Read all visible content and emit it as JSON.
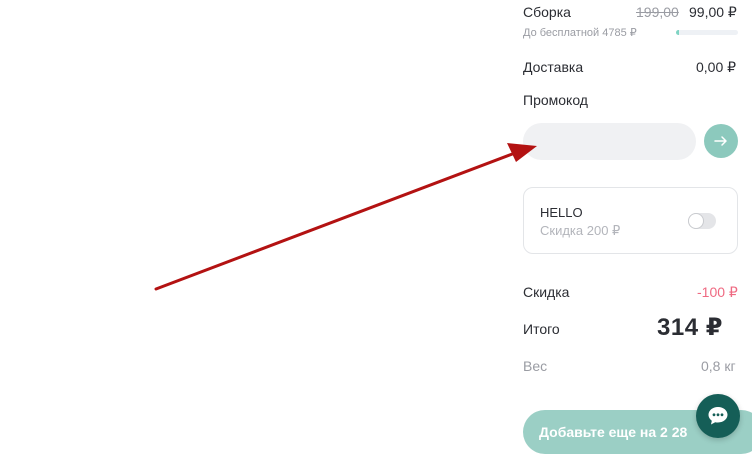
{
  "summary": {
    "assembly": {
      "label": "Сборка",
      "old_price": "199,00",
      "price": "99,00 ₽",
      "free_hint": "До бесплатной 4785 ₽",
      "progress_fraction": 0.05
    },
    "delivery": {
      "label": "Доставка",
      "value": "0,00 ₽"
    },
    "promo": {
      "label": "Промокод",
      "input_value": "",
      "placeholder": "",
      "submit_icon": "arrow-right-icon"
    },
    "coupon": {
      "code": "HELLO",
      "description": "Скидка 200 ₽",
      "enabled": false
    },
    "discount": {
      "label": "Скидка",
      "value": "-100 ₽"
    },
    "total": {
      "label": "Итого",
      "value": "314 ₽"
    },
    "weight": {
      "label": "Вес",
      "value": "0,8 кг"
    },
    "cta": {
      "label": "Добавьте еще на 2 28"
    },
    "chat": {
      "icon": "chat-bubble-icon"
    }
  },
  "colors": {
    "accent": "#8cc9bd",
    "accent_dark": "#155e57",
    "discount": "#ef6a82",
    "annotation_arrow": "#b31212"
  }
}
